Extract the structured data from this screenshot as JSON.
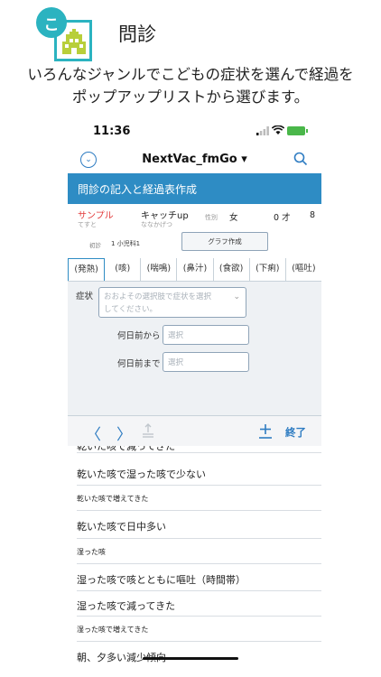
{
  "promo": {
    "badge": "こ",
    "title": "問診",
    "description_line1": "いろんなジャンルでこどもの症状を選んで経過を",
    "description_line2": "ポップアップリストから選びます。"
  },
  "status_bar": {
    "time": "11:36",
    "signal_icon": "signal-bars-icon",
    "wifi_icon": "wifi-icon",
    "battery_icon": "battery-charging-icon",
    "battery_color": "#4ab74a"
  },
  "app_bar": {
    "menu_icon": "chevron-circle-icon",
    "title": "NextVac_fmGo ▾",
    "search_icon": "search-icon"
  },
  "section": {
    "title": "問診の記入と経過表作成",
    "color": "#2e8cc4"
  },
  "patient": {
    "name": "サンプル",
    "name_kana": "てすと",
    "catchphrase": "キャッチup",
    "catchphrase_kana": "ななかげつ",
    "sex_label": "性別",
    "sex": "女",
    "age_years": "0 才",
    "age_months": "8",
    "visit_label": "初診",
    "visit": "1  小児科1",
    "graph_button": "グラフ作成"
  },
  "tabs": [
    "(発熱)",
    "(咳)",
    "(喘鳴)",
    "(鼻汁)",
    "(食欲)",
    "(下痢)",
    "(嘔吐)"
  ],
  "form": {
    "symptom_label": "症状",
    "symptom_placeholder_1": "おおよその選択肢で症状を選択",
    "symptom_placeholder_2": "してください。",
    "days_from_label": "何日前から",
    "days_from_placeholder": "選択",
    "days_to_label": "何日前まで",
    "days_to_placeholder": "選択"
  },
  "toolbar": {
    "prev_icon": "chevron-left-icon",
    "next_icon": "chevron-right-icon",
    "share_icon": "share-icon",
    "add_icon": "plus-icon",
    "done_label": "終了",
    "accent": "#2e7cc2"
  },
  "popup_list": [
    "乾いた咳で減ってきた",
    "乾いた咳で湿った咳で少ない",
    "乾いた咳で増えてきた",
    "乾いた咳で日中多い",
    "湿った咳",
    "湿った咳で咳とともに嘔吐（時間帯）",
    "湿った咳で減ってきた",
    "湿った咳で増えてきた",
    "朝、夕多い減少傾向"
  ]
}
